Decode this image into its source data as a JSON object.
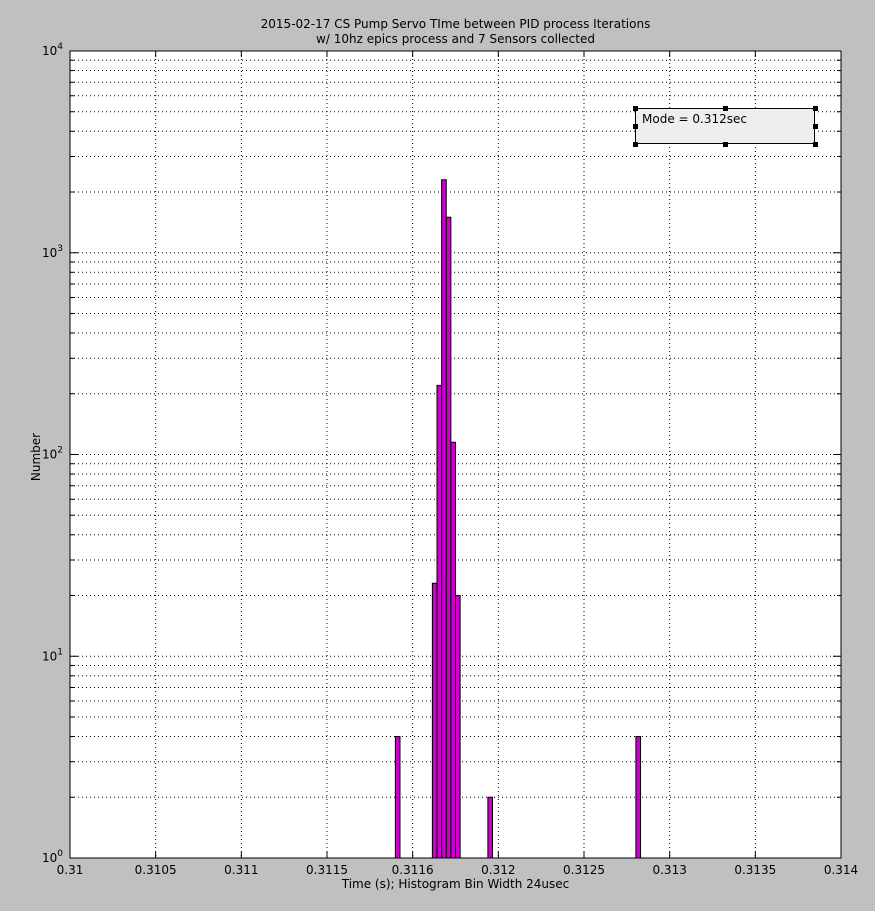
{
  "title_line1": "2015-02-17 CS Pump Servo TIme between PID process Iterations",
  "title_line2": "w/ 10hz epics process and 7 Sensors collected",
  "annotation": "Mode = 0.312sec",
  "colors": {
    "bar_fill": "#cc00cc",
    "bar_edge": "#000000",
    "background": "#c0c0c0",
    "axes_bg": "#ffffff",
    "annotation_bg": "#eeeeee"
  },
  "chart_data": {
    "type": "bar",
    "xlabel": "Time (s); Histogram Bin Width 24usec",
    "ylabel": "Number",
    "xlim": [
      0.31,
      0.314
    ],
    "ylim": [
      1,
      10000
    ],
    "yscale": "log",
    "grid": true,
    "xticks": [
      "0.31",
      "0.3105",
      "0.311",
      "0.3115",
      "0.3116",
      "0.312",
      "0.3125",
      "0.313",
      "0.3135",
      "0.314"
    ],
    "yticks": [
      1,
      10,
      100,
      1000,
      10000
    ],
    "bin_width": 2.4e-05,
    "bins": [
      {
        "x": 0.3117,
        "count": 4
      },
      {
        "x": 0.311892,
        "count": 23
      },
      {
        "x": 0.311916,
        "count": 220
      },
      {
        "x": 0.31194,
        "count": 2300
      },
      {
        "x": 0.311964,
        "count": 1500
      },
      {
        "x": 0.311988,
        "count": 115
      },
      {
        "x": 0.312012,
        "count": 20
      },
      {
        "x": 0.31218,
        "count": 2
      },
      {
        "x": 0.312948,
        "count": 4
      }
    ]
  }
}
